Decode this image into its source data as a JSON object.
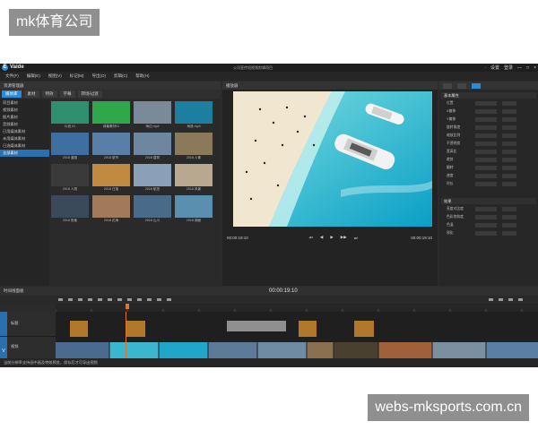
{
  "watermarks": {
    "top_left": "mk体育公司",
    "bottom_right": "webs-mksports.com.cn"
  },
  "app": {
    "logo_letter": "E",
    "name": "Vaide",
    "project_title": "公司宣传短视频剪辑项目",
    "title_right": [
      "·",
      "设置",
      "登录",
      "—",
      "□",
      "×"
    ],
    "menu": [
      "文件(F)",
      "编辑(E)",
      "视图(V)",
      "标记(M)",
      "导出(O)",
      "剪辑(C)",
      "帮助(H)"
    ]
  },
  "library": {
    "header": "资源管理器",
    "tabs": [
      "媒体库",
      "素材",
      "特效",
      "字幕",
      "转场/过渡"
    ],
    "tree": [
      "项目素材",
      "视频素材",
      "图片素材",
      "音频素材",
      "已用媒体素材",
      "未用媒体素材",
      "已选媒体素材",
      "全部素材"
    ],
    "tree_selected_index": 7,
    "thumbs": [
      {
        "label": "片段 01",
        "color": "#2f8f6f"
      },
      {
        "label": "绿幕素材01",
        "color": "#2ea84a"
      },
      {
        "label": "海边.mp4",
        "color": "#7a8a99"
      },
      {
        "label": "海浪.mp4",
        "color": "#1c7fa0"
      },
      {
        "label": "2018 道路",
        "color": "#3f6fa0"
      },
      {
        "label": "2018 城市",
        "color": "#5a7fa6"
      },
      {
        "label": "2018 建筑",
        "color": "#6f86a1"
      },
      {
        "label": "2018 人像",
        "color": "#8a7a5a"
      },
      {
        "label": "2018 人物",
        "color": "#3a3a3a"
      },
      {
        "label": "2018 日落",
        "color": "#c08a40"
      },
      {
        "label": "2018 航拍",
        "color": "#8aa0b8"
      },
      {
        "label": "2018 风景",
        "color": "#b8a890"
      },
      {
        "label": "2018 夜景",
        "color": "#3a4a5a"
      },
      {
        "label": "2018 花海",
        "color": "#a07a5a"
      },
      {
        "label": "2018 山川",
        "color": "#4a6a8a"
      },
      {
        "label": "2018 湖面",
        "color": "#5a8fb0"
      }
    ]
  },
  "preview": {
    "header": "播放器",
    "time_left": "00:00:19:10",
    "controls": [
      "⏮",
      "◀",
      "▶",
      "▶▶",
      "⏭"
    ],
    "time_right": "00:00:19:10"
  },
  "inspector": {
    "section1": "基本属性",
    "props1": [
      "位置",
      "X偏移",
      "Y偏移",
      "旋转角度",
      "缩放比例",
      "不透明度",
      "宽高比",
      "裁剪",
      "翻转",
      "速度",
      "时长"
    ],
    "section2": "效果",
    "props2": [
      "亮度对比度",
      "色彩饱和度",
      "色温",
      "锐化"
    ]
  },
  "timeline": {
    "header": "时间线面板",
    "timecode": "00:00:19:10",
    "tracks": [
      {
        "side": "",
        "label": "标题"
      },
      {
        "side": "V",
        "label": "视频"
      },
      {
        "side": "A",
        "label": "音频"
      },
      {
        "side": "",
        "label": "配乐"
      },
      {
        "side": "",
        "label": "配音"
      }
    ],
    "status": "当前分辨率支持画中画及特效预览，保存后才可导出视频"
  }
}
